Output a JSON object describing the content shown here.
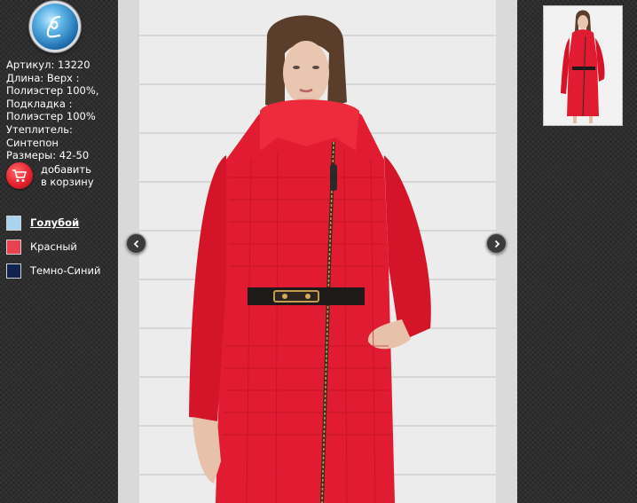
{
  "logo": {
    "icon": "script-l-logo-icon",
    "letter": "L"
  },
  "product": {
    "lines": [
      "Артикул: 13220",
      "Длина: Верх :",
      "Полиэстер 100%,",
      "Подкладка :",
      "Полиэстер 100%",
      "Утеплитель:",
      "Синтепон",
      "Размеры: 42-50"
    ]
  },
  "cart": {
    "line1": "добавить",
    "line2": "в корзину",
    "icon": "cart-icon"
  },
  "colors": [
    {
      "label": "Голубой",
      "hex": "#a9d4ef",
      "selected": true
    },
    {
      "label": "Красный",
      "hex": "#e8414f",
      "selected": false
    },
    {
      "label": "Темно-Синий",
      "hex": "#10234f",
      "selected": false
    }
  ],
  "gallery": {
    "prev_icon": "chevron-left-icon",
    "next_icon": "chevron-right-icon",
    "coat_color": "#e11c32",
    "wall_color": "#ececec"
  }
}
